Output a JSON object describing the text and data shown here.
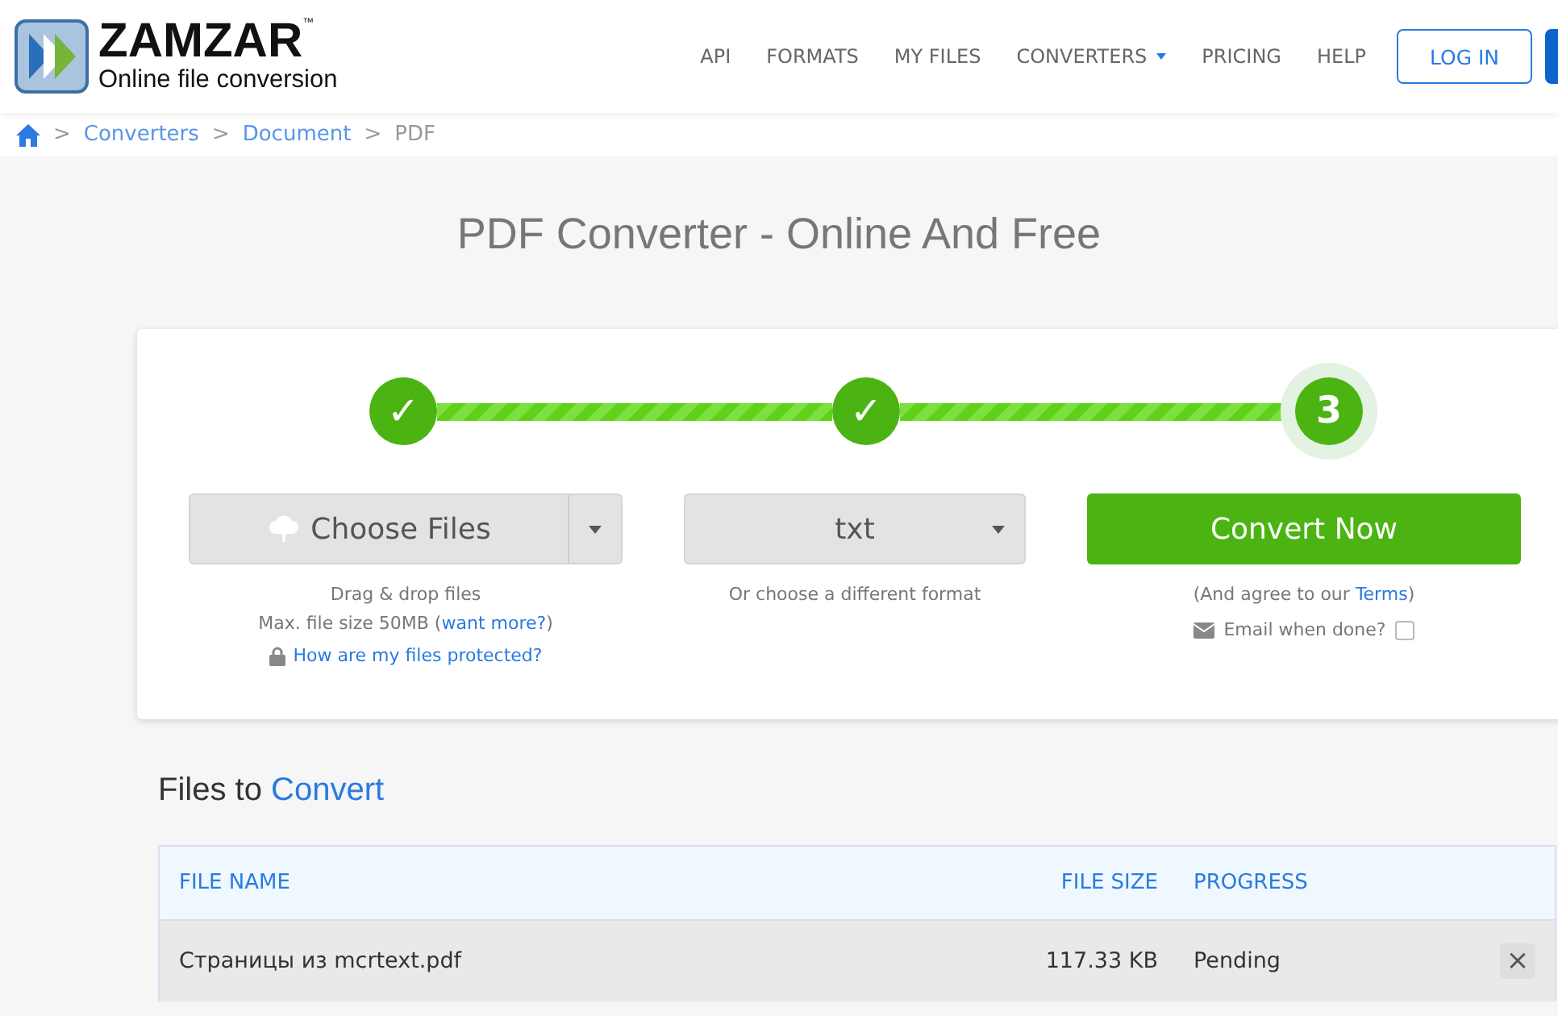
{
  "header": {
    "logo": {
      "name": "ZAMZAR",
      "trademark": "™",
      "tagline": "Online file conversion"
    },
    "nav": [
      {
        "label": "API",
        "dropdown": false
      },
      {
        "label": "FORMATS",
        "dropdown": false
      },
      {
        "label": "MY FILES",
        "dropdown": false
      },
      {
        "label": "CONVERTERS",
        "dropdown": true
      },
      {
        "label": "PRICING",
        "dropdown": false
      },
      {
        "label": "HELP",
        "dropdown": false
      }
    ],
    "login": "LOG IN"
  },
  "breadcrumb": [
    {
      "separator": ">",
      "label": "Converters",
      "current": false
    },
    {
      "separator": ">",
      "label": "Document",
      "current": false
    },
    {
      "separator": ">",
      "label": "PDF",
      "current": true
    }
  ],
  "title": "PDF Converter - Online And Free",
  "steps": [
    {
      "label": "✓",
      "done": true
    },
    {
      "label": "✓",
      "done": true
    },
    {
      "label": "3",
      "done": false
    }
  ],
  "connectors": [
    {
      "level": 1
    },
    {
      "level": 1
    }
  ],
  "choose": {
    "label": "Choose Files",
    "hint": "Drag & drop files",
    "limit": "Max. file size 50MB (",
    "limit_link": "want more?",
    "limit_end": ")",
    "protect_link": "How are my files protected?"
  },
  "format": {
    "value": "txt",
    "hint": "Or choose a different format"
  },
  "convert": {
    "label": "Convert Now",
    "agree": "(And agree to our ",
    "agree_link": "Terms",
    "agree_end": ")",
    "email_label": "Email when done?",
    "email_checked": false
  },
  "files": {
    "heading": "Files to **Convert**",
    "columns": [
      "FILE NAME",
      "FILE SIZE",
      "PROGRESS"
    ],
    "rows": [
      {
        "name": "Страницы из mcrtext.pdf",
        "size": "117.33 KB",
        "progress": "Pending",
        "remove": "×"
      }
    ]
  }
}
